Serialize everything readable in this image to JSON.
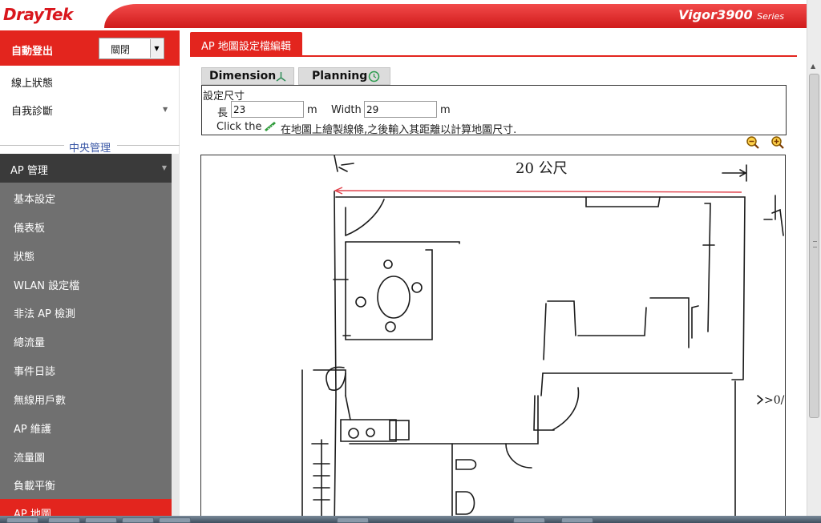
{
  "header": {
    "logo_dray": "Dray",
    "logo_tek": "Tek",
    "model": "Vigor3900",
    "series": "Series"
  },
  "sidebar": {
    "auto_logout_label": "自動登出",
    "auto_logout_value": "關閉",
    "links": [
      "線上狀態",
      "自我診斷"
    ],
    "central_label": "中央管理",
    "ap_mgmt": "AP 管理",
    "submenu": [
      "基本設定",
      "儀表板",
      "狀態",
      "WLAN 設定檔",
      "非法 AP 檢測",
      "總流量",
      "事件日誌",
      "無線用戶數",
      "AP 維護",
      "流量圖",
      "負載平衡",
      "AP 地圖"
    ],
    "active_item": "AP 地圖"
  },
  "main": {
    "page_tab": "AP 地圖設定檔編輯",
    "tabs": [
      {
        "label": "Dimension",
        "icon": "dimension-icon"
      },
      {
        "label": "Planning",
        "icon": "clock-icon"
      }
    ],
    "dimension": {
      "title": "設定尺寸",
      "length_label": "長",
      "length_value": "23",
      "length_unit": "m",
      "width_label": "Width",
      "width_value": "29",
      "width_unit": "m",
      "hint_prefix": "Click the",
      "hint_suffix": "在地圖上繪製線條,之後輸入其距離以計算地圖尺寸."
    },
    "map": {
      "sketch_annotation_top": "20 公尺",
      "sketch_annotation_right": ">0/"
    }
  },
  "colors": {
    "brand_red": "#e3251e",
    "sidebar_dark": "#3a3a3a",
    "sidebar_gray": "#707070",
    "central_blue": "#3b58a6",
    "measure_line": "#e0404a"
  }
}
